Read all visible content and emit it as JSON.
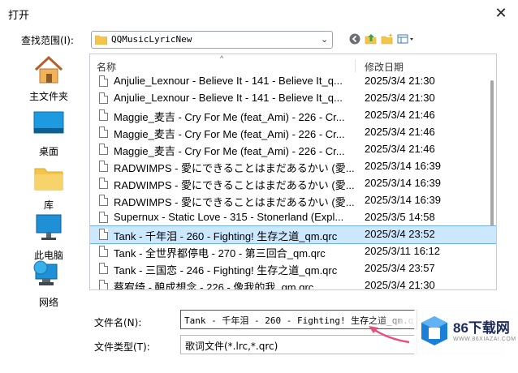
{
  "window": {
    "title": "打开",
    "close_glyph": "✕"
  },
  "lookin": {
    "label": "查找范围(I):",
    "value": "QQMusicLyricNew",
    "arrow": "⌄"
  },
  "toolbar_icons": [
    "back-icon",
    "up-folder-icon",
    "new-folder-icon",
    "view-menu-icon"
  ],
  "places": [
    {
      "label": "主文件夹",
      "icon": "home-icon"
    },
    {
      "label": "桌面",
      "icon": "desktop-icon"
    },
    {
      "label": "库",
      "icon": "library-icon"
    },
    {
      "label": "此电脑",
      "icon": "computer-icon"
    },
    {
      "label": "网络",
      "icon": "network-icon"
    }
  ],
  "filelist": {
    "columns": {
      "name": "名称",
      "date": "修改日期",
      "sort_glyph": "^"
    },
    "rows": [
      {
        "name": "Anjulie_Lexnour - Believe It - 141 - Believe It_q...",
        "date": "2025/3/4 21:30",
        "selected": false
      },
      {
        "name": "Anjulie_Lexnour - Believe It - 141 - Believe It_q...",
        "date": "2025/3/4 21:30",
        "selected": false
      },
      {
        "name": "Maggie_麦吉 - Cry For Me (feat_Ami) - 226 - Cr...",
        "date": "2025/3/4 21:46",
        "selected": false
      },
      {
        "name": "Maggie_麦吉 - Cry For Me (feat_Ami) - 226 - Cr...",
        "date": "2025/3/4 21:46",
        "selected": false
      },
      {
        "name": "Maggie_麦吉 - Cry For Me (feat_Ami) - 226 - Cr...",
        "date": "2025/3/4 21:46",
        "selected": false
      },
      {
        "name": "RADWIMPS - 愛にできることはまだあるかい (愛...",
        "date": "2025/3/14 16:39",
        "selected": false
      },
      {
        "name": "RADWIMPS - 愛にできることはまだあるかい (愛...",
        "date": "2025/3/14 16:39",
        "selected": false
      },
      {
        "name": "RADWIMPS - 愛にできることはまだあるかい (愛...",
        "date": "2025/3/14 16:39",
        "selected": false
      },
      {
        "name": "Supernux - Static Love - 315 - Stonerland (Expl...",
        "date": "2025/3/5 14:58",
        "selected": false
      },
      {
        "name": "Tank - 千年泪 - 260 - Fighting! 生存之道_qm.qrc",
        "date": "2025/3/4 23:52",
        "selected": true
      },
      {
        "name": "Tank - 全世界都停电 - 270 - 第三回合_qm.qrc",
        "date": "2025/3/11 16:12",
        "selected": false
      },
      {
        "name": "Tank - 三国恋 - 246 - Fighting! 生存之道_qm.qrc",
        "date": "2025/3/4 23:57",
        "selected": false
      },
      {
        "name": "蔡宥绮 - 酿成想念 - 226 - 像我的我_qm.qrc",
        "date": "2025/3/4 21:30",
        "selected": false
      }
    ]
  },
  "filename": {
    "label": "文件名(N):",
    "value": "Tank - 千年泪 - 260 - Fighting! 生存之道_qm.qrc"
  },
  "filetype": {
    "label": "文件类型(T):",
    "value": "歌词文件(*.lrc,*.qrc)"
  },
  "watermark": {
    "text": "86下载网",
    "sub": "WWW.86XIAZAI.COM"
  },
  "colors": {
    "selection": "#cce8ff",
    "selection_border": "#6fb0e8",
    "folder": "#f4c54a",
    "arrow": "#e8507a"
  }
}
